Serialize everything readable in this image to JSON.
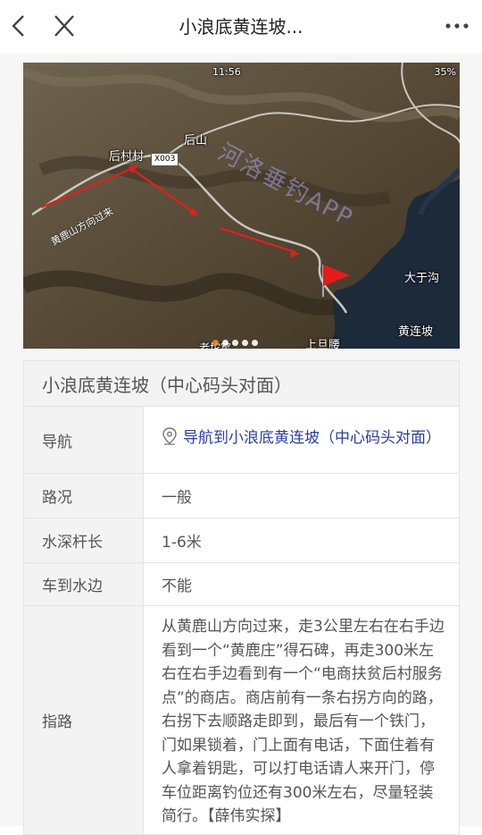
{
  "header": {
    "title": "小浪底黄连坡..."
  },
  "map": {
    "status_time": "11:56",
    "status_battery": "35%",
    "places": {
      "houcun": "后村村",
      "houshan": "后山",
      "dayugou": "大于沟",
      "huanglianpo": "黄连坡",
      "shangdanyao": "上旦腰",
      "laozhaiku": "老坨窑"
    },
    "direction_label": "黄鹿山方向过来",
    "road_tag": "X003",
    "watermark": "河洛垂钓APP",
    "carousel_count": 5,
    "carousel_active": 1
  },
  "info": {
    "title": "小浪底黄连坡（中心码头对面）",
    "nav_key": "导航",
    "nav_value": "导航到小浪底黄连坡（中心码头对面）",
    "road_key": "路况",
    "road_value": "一般",
    "depth_key": "水深杆长",
    "depth_value": "1-6米",
    "car_key": "车到水边",
    "car_value": "不能",
    "route_key": "指路",
    "route_value": "从黄鹿山方向过来，走3公里左右在右手边看到一个“黄鹿庄”得石碑，再走300米左右在右手边看到有一个“电商扶贫后村服务点”的商店。商店前有一条右拐方向的路，右拐下去顺路走即到，最后有一个铁门，门如果锁着，门上面有电话，下面住着有人拿着钥匙，可以打电话请人来开门，停车位距离钓位还有300米左右，尽量轻装简行。【薛伟实探】"
  }
}
